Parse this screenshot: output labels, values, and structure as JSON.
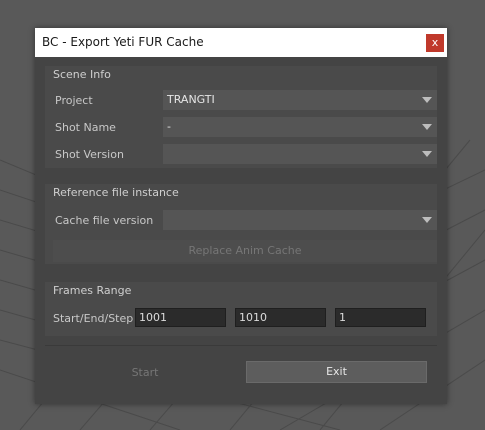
{
  "window": {
    "title": "BC - Export Yeti FUR Cache",
    "close_glyph": "x"
  },
  "scene_info": {
    "title": "Scene Info",
    "project_label": "Project",
    "project_value": "TRANGTI",
    "shot_name_label": "Shot Name",
    "shot_name_value": "-",
    "shot_version_label": "Shot Version",
    "shot_version_value": ""
  },
  "reference": {
    "title": "Reference file instance",
    "cache_version_label": "Cache file version",
    "cache_version_value": "",
    "replace_button": "Replace Anim Cache"
  },
  "frames": {
    "title": "Frames Range",
    "label": "Start/End/Step",
    "start": "1001",
    "end": "1010",
    "step": "1"
  },
  "actions": {
    "start_button": "Start",
    "exit_button": "Exit"
  },
  "colors": {
    "close_button": "#c0392b",
    "dialog_bg": "#444444",
    "group_bg": "#4a4a4a"
  }
}
